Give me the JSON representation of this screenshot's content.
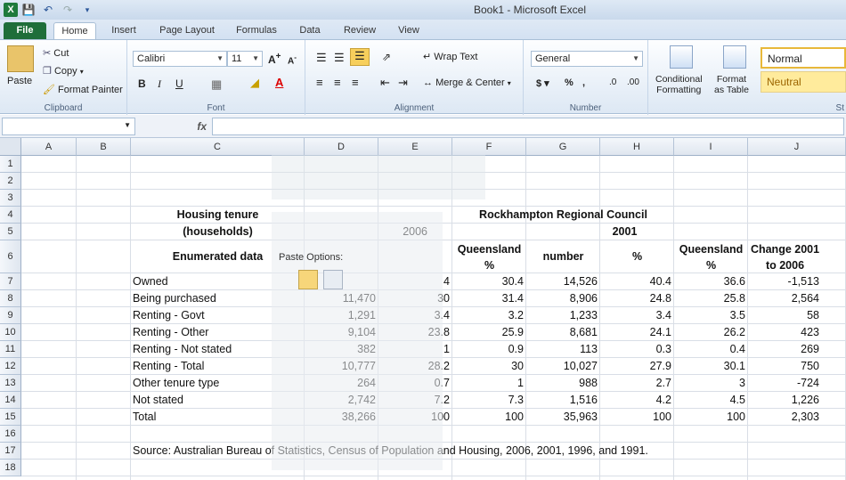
{
  "window": {
    "title": "Book1 - Microsoft Excel"
  },
  "tabs": [
    "File",
    "Home",
    "Insert",
    "Page Layout",
    "Formulas",
    "Data",
    "Review",
    "View"
  ],
  "clipboard": {
    "paste": "Paste",
    "cut": "Cut",
    "copy": "Copy",
    "format_painter": "Format Painter",
    "label": "Clipboard"
  },
  "font": {
    "name": "Calibri",
    "size": "11",
    "label": "Font"
  },
  "alignment": {
    "wrap_text": "Wrap Text",
    "merge_center": "Merge & Center",
    "label": "Alignment"
  },
  "number": {
    "format": "General",
    "label": "Number"
  },
  "styles": {
    "conditional_1": "Conditional",
    "conditional_2": "Formatting",
    "format_1": "Format",
    "format_2": "as Table",
    "normal": "Normal",
    "neutral": "Neutral",
    "label": "St"
  },
  "formula_bar": {
    "fx": "fx"
  },
  "columns": [
    "A",
    "B",
    "C",
    "D",
    "E",
    "F",
    "G",
    "H",
    "I",
    "J"
  ],
  "rows": [
    "1",
    "2",
    "3",
    "4",
    "5",
    "6",
    "7",
    "8",
    "9",
    "10",
    "11",
    "12",
    "13",
    "14",
    "15",
    "16",
    "17",
    "18"
  ],
  "sheet": {
    "c4": "Housing tenure",
    "c5": "(households)",
    "c6": "Enumerated data",
    "region": "Rockhampton Regional Council",
    "y2006": "2006",
    "y2001": "2001",
    "f6a": "Queensland",
    "f6b": "%",
    "g6": "number",
    "h6": "%",
    "i6a": "Queensland",
    "i6b": "%",
    "j6a": "Change 2001",
    "j6b": "to 2006",
    "data_rows": [
      {
        "label": "Owned",
        "d": "",
        "e": "4",
        "f": "30.4",
        "g": "14,526",
        "h": "40.4",
        "i": "36.6",
        "j": "-1,513"
      },
      {
        "label": "Being purchased",
        "d": "11,470",
        "e": "30",
        "f": "31.4",
        "g": "8,906",
        "h": "24.8",
        "i": "25.8",
        "j": "2,564"
      },
      {
        "label": "Renting - Govt",
        "d": "1,291",
        "e": "3.4",
        "f": "3.2",
        "g": "1,233",
        "h": "3.4",
        "i": "3.5",
        "j": "58"
      },
      {
        "label": "Renting - Other",
        "d": "9,104",
        "e": "23.8",
        "f": "25.9",
        "g": "8,681",
        "h": "24.1",
        "i": "26.2",
        "j": "423"
      },
      {
        "label": "Renting - Not stated",
        "d": "382",
        "e": "1",
        "f": "0.9",
        "g": "113",
        "h": "0.3",
        "i": "0.4",
        "j": "269"
      },
      {
        "label": "Renting - Total",
        "d": "10,777",
        "e": "28.2",
        "f": "30",
        "g": "10,027",
        "h": "27.9",
        "i": "30.1",
        "j": "750"
      },
      {
        "label": "Other tenure type",
        "d": "264",
        "e": "0.7",
        "f": "1",
        "g": "988",
        "h": "2.7",
        "i": "3",
        "j": "-724"
      },
      {
        "label": "Not stated",
        "d": "2,742",
        "e": "7.2",
        "f": "7.3",
        "g": "1,516",
        "h": "4.2",
        "i": "4.5",
        "j": "1,226"
      },
      {
        "label": "Total",
        "d": "38,266",
        "e": "100",
        "f": "100",
        "g": "35,963",
        "h": "100",
        "i": "100",
        "j": "2,303"
      }
    ],
    "source": "Source: Australian Bureau of Statistics, Census of Population and Housing, 2006, 2001, 1996, and 1991."
  },
  "paste_options": {
    "title": "Paste Options:"
  }
}
